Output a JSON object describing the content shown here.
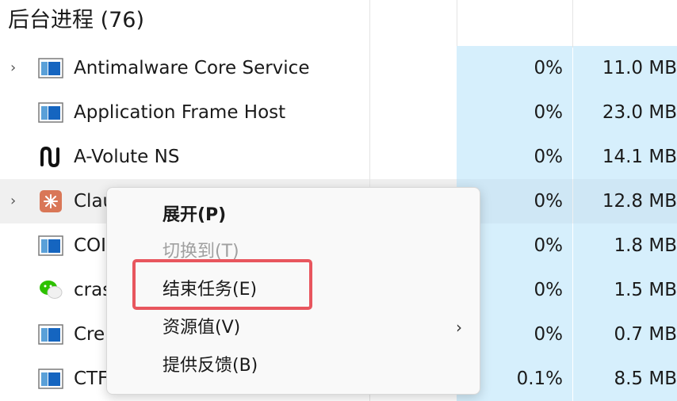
{
  "section": {
    "title": "后台进程 (76)"
  },
  "processes": [
    {
      "name": "Antimalware Core Service",
      "cpu": "0%",
      "memory": "11.0 MB",
      "expandable": true,
      "icon": "app-window-icon"
    },
    {
      "name": "Application Frame Host",
      "cpu": "0%",
      "memory": "23.0 MB",
      "expandable": false,
      "icon": "app-window-icon"
    },
    {
      "name": "A-Volute NS",
      "cpu": "0%",
      "memory": "14.1 MB",
      "expandable": false,
      "icon": "avolute-wave-icon"
    },
    {
      "name": "Clau",
      "cpu": "0%",
      "memory": "12.8 MB",
      "expandable": true,
      "icon": "claude-logo-icon"
    },
    {
      "name": "COI",
      "cpu": "0%",
      "memory": "1.8 MB",
      "expandable": false,
      "icon": "app-window-icon"
    },
    {
      "name": "cras",
      "cpu": "0%",
      "memory": "1.5 MB",
      "expandable": false,
      "icon": "wechat-icon"
    },
    {
      "name": "Cre",
      "cpu": "0%",
      "memory": "0.7 MB",
      "expandable": false,
      "icon": "app-window-icon"
    },
    {
      "name": "CTF",
      "cpu": "0.1%",
      "memory": "8.5 MB",
      "expandable": false,
      "icon": "app-window-icon"
    }
  ],
  "context_menu": {
    "items": [
      {
        "label": "展开(P)",
        "style": "bold"
      },
      {
        "label": "切换到(T)",
        "style": "disabled"
      },
      {
        "label": "结束任务(E)",
        "style": "normal",
        "highlighted": true
      },
      {
        "label": "资源值(V)",
        "style": "normal",
        "submenu_icon": "chevron-right-icon",
        "submenu_glyph": "›"
      },
      {
        "label": "提供反馈(B)",
        "style": "normal"
      }
    ]
  },
  "colors": {
    "column_tint": "#d6effc",
    "highlight_border": "#e8565e",
    "hover_row": "#f0f0f0"
  },
  "chevron_glyph": "›"
}
